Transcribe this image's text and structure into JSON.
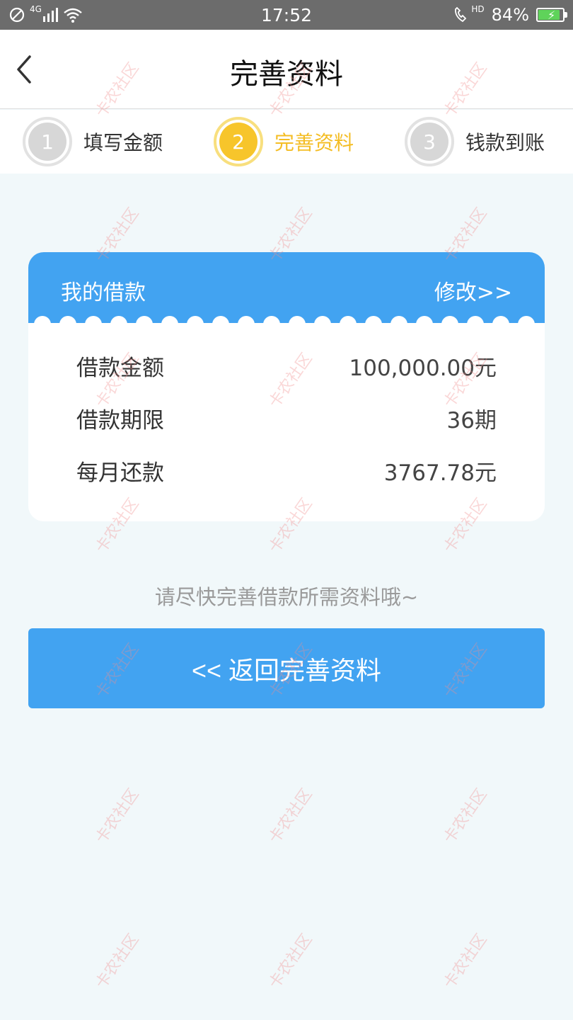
{
  "status_bar": {
    "network": "4G",
    "time": "17:52",
    "call_badge": "HD",
    "battery_percent": "84%",
    "battery_level": 0.84
  },
  "header": {
    "title": "完善资料"
  },
  "steps": [
    {
      "number": "1",
      "label": "填写金额",
      "state": "inactive"
    },
    {
      "number": "2",
      "label": "完善资料",
      "state": "active"
    },
    {
      "number": "3",
      "label": "钱款到账",
      "state": "inactive"
    }
  ],
  "loan_card": {
    "title": "我的借款",
    "edit_label": "修改>>",
    "rows": [
      {
        "label": "借款金额",
        "value": "100,000.00元"
      },
      {
        "label": "借款期限",
        "value": "36期"
      },
      {
        "label": "每月还款",
        "value": "3767.78元"
      }
    ]
  },
  "hint": "请尽快完善借款所需资料哦~",
  "action_button": "<< 返回完善资料",
  "watermark": "卡农社区",
  "colors": {
    "primary": "#42a3f1",
    "active_step": "#f7c52b",
    "background": "#f1f8fa"
  }
}
